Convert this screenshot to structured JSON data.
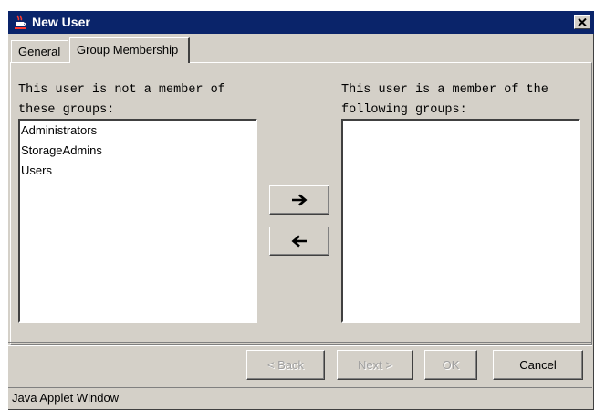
{
  "window": {
    "title": "New User",
    "icon": "java-cup-icon",
    "title_bar_color": "#0a246a"
  },
  "tabs": [
    {
      "label": "General",
      "selected": false
    },
    {
      "label": "Group Membership",
      "selected": true
    }
  ],
  "left_panel": {
    "label_line1": "This user is not a member of",
    "label_line2": "these groups:",
    "items": [
      "Administrators",
      "StorageAdmins",
      "Users"
    ]
  },
  "right_panel": {
    "label_line1": "This user is a member of the",
    "label_line2": "following groups:",
    "items": []
  },
  "transfer_buttons": {
    "add_icon": "arrow-right-icon",
    "remove_icon": "arrow-left-icon"
  },
  "buttons": {
    "back": "< Back",
    "next": "Next >",
    "ok": "OK",
    "cancel": "Cancel"
  },
  "status": "Java Applet Window"
}
